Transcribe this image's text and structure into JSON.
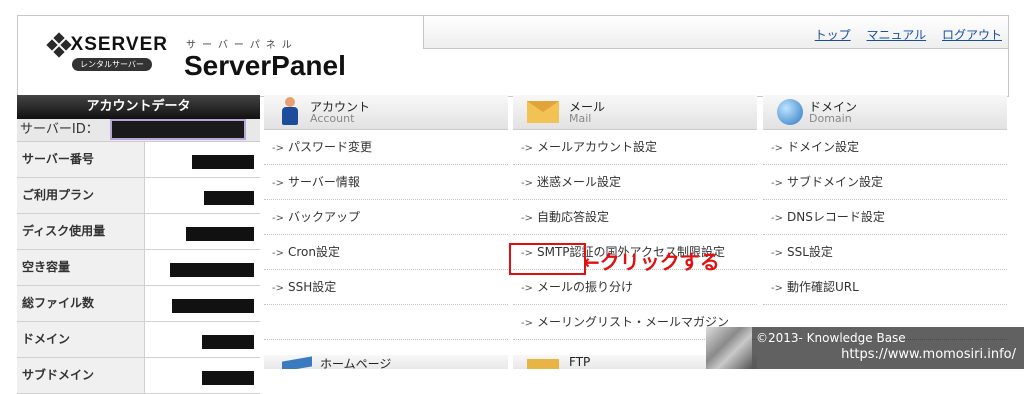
{
  "header": {
    "logo": {
      "name": "XSERVER",
      "badge": "レンタルサーバー"
    },
    "panel_ruby": "サーバーパネル",
    "panel_title": "ServerPanel",
    "links": [
      {
        "label": "トップ"
      },
      {
        "label": "マニュアル"
      },
      {
        "label": "ログアウト"
      }
    ]
  },
  "sidebar": {
    "title": "アカウントデータ",
    "server_id_label": "サーバーID：",
    "rows": [
      {
        "label": "サーバー番号"
      },
      {
        "label": "ご利用プラン"
      },
      {
        "label": "ディスク使用量"
      },
      {
        "label": "空き容量"
      },
      {
        "label": "総ファイル数"
      },
      {
        "label": "ドメイン"
      },
      {
        "label": "サブドメイン"
      }
    ]
  },
  "columns": [
    {
      "title": "アカウント",
      "subtitle": "Account",
      "icon": "account-icon",
      "items": [
        "パスワード変更",
        "サーバー情報",
        "バックアップ",
        "Cron設定",
        "SSH設定",
        ""
      ]
    },
    {
      "title": "メール",
      "subtitle": "Mail",
      "icon": "mail-icon",
      "items": [
        "メールアカウント設定",
        "迷惑メール設定",
        "自動応答設定",
        "SMTP認証の国外アクセス制限設定",
        "メールの振り分け",
        "メーリングリスト・メールマガジン"
      ]
    },
    {
      "title": "ドメイン",
      "subtitle": "Domain",
      "icon": "globe-icon",
      "items": [
        "ドメイン設定",
        "サブドメイン設定",
        "DNSレコード設定",
        "SSL設定",
        "動作確認URL",
        ""
      ]
    }
  ],
  "bottom_sections": [
    {
      "title": "ホームページ",
      "icon": "homepage-icon"
    },
    {
      "title": "FTP",
      "icon": "ftp-icon"
    }
  ],
  "annotation": {
    "text": "←クリックする",
    "color": "#e01010"
  },
  "watermark": {
    "line1": "©2013- Knowledge Base",
    "line2": "https://www.momosiri.info/"
  },
  "colors": {
    "accent_red": "#e01010",
    "link_blue": "#1a4fa3"
  }
}
